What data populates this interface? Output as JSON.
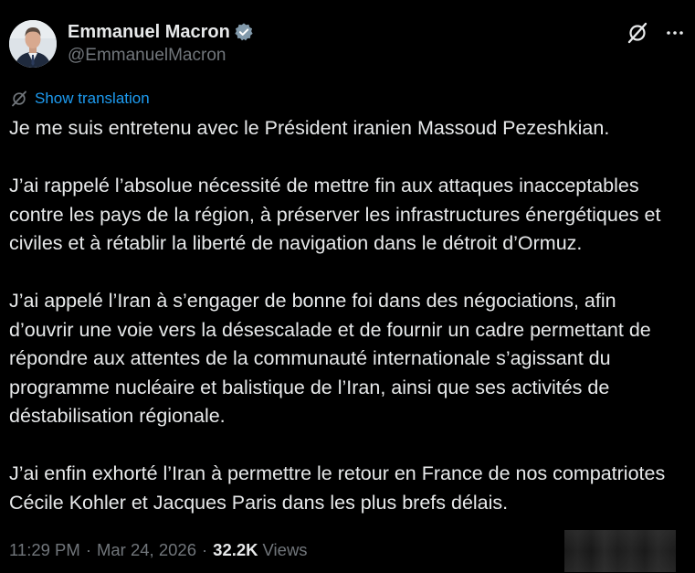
{
  "author": {
    "display_name": "Emmanuel Macron",
    "handle": "@EmmanuelMacron",
    "verified": true,
    "verified_color": "#1d9bf0"
  },
  "header_icons": {
    "grok": "grok-icon",
    "more": "more-icon"
  },
  "translation": {
    "label": "Show translation",
    "icon": "translate-icon"
  },
  "tweet": {
    "paragraphs": [
      "Je me suis entretenu avec le Président iranien Massoud Pezeshkian.",
      "J’ai rappelé l’absolue nécessité de mettre fin aux attaques inacceptables contre les pays de la région, à préserver les infrastructures énergétiques et civiles et à rétablir la liberté de navigation dans le détroit d’Ormuz.",
      "J’ai appelé l’Iran à s’engager de bonne foi dans des négociations, afin d’ouvrir une voie vers la désescalade et de fournir un cadre permettant de répondre aux attentes de la communauté internationale s’agissant du programme nucléaire et balistique de l’Iran, ainsi que ses activités de déstabilisation régionale.",
      "J’ai enfin exhorté l’Iran à permettre le retour en France de nos compatriotes Cécile Kohler et Jacques Paris dans les plus brefs délais."
    ]
  },
  "meta": {
    "time": "11:29 PM",
    "separator": "·",
    "date": "Mar 24, 2026",
    "views_count": "32.2K",
    "views_label": "Views"
  },
  "colors": {
    "background": "#000000",
    "text": "#e7e9ea",
    "secondary": "#71767b",
    "link": "#1d9bf0"
  }
}
